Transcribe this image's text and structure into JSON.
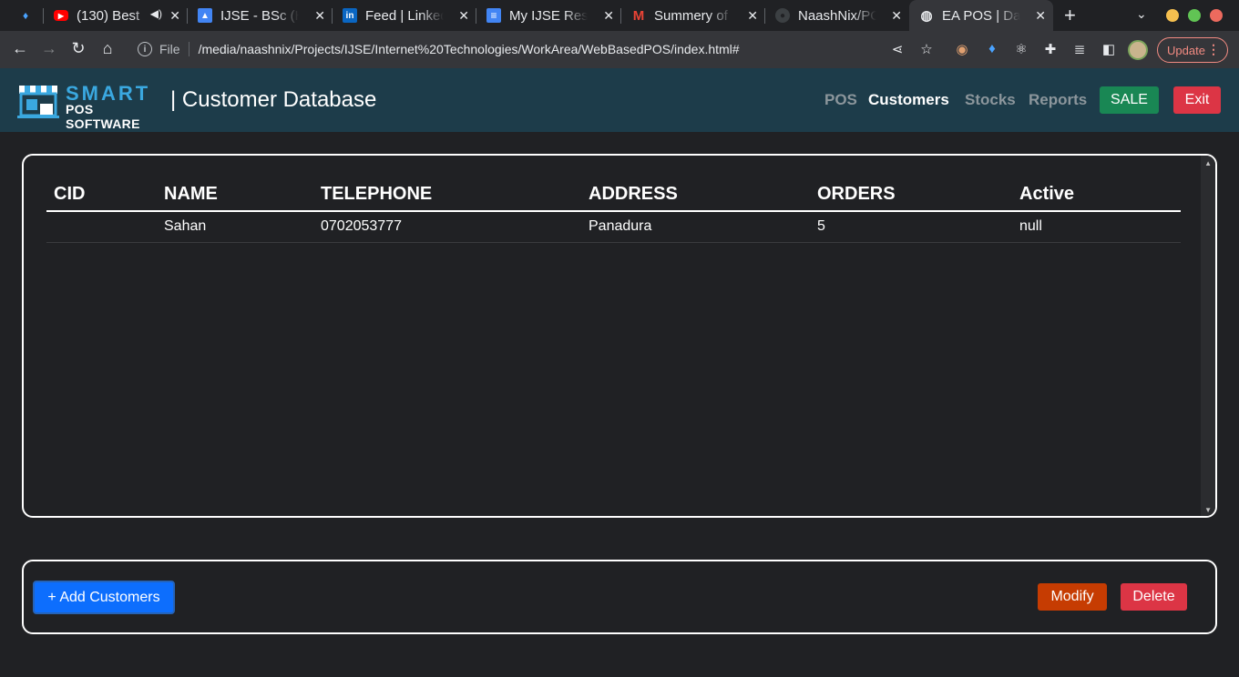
{
  "browser": {
    "tabs": [
      {
        "title": "",
        "icon": "gem-icon"
      },
      {
        "title": "(130) Best",
        "icon": "youtube-icon",
        "audio": true
      },
      {
        "title": "IJSE - BSc (H",
        "icon": "google-sites-icon"
      },
      {
        "title": "Feed | Linkedl",
        "icon": "linkedin-icon"
      },
      {
        "title": "My IJSE Resu",
        "icon": "google-docs-icon"
      },
      {
        "title": "Summery of M",
        "icon": "gmail-icon"
      },
      {
        "title": "NaashNix/PO",
        "icon": "github-icon"
      },
      {
        "title": "EA POS | Das",
        "icon": "globe-icon",
        "active": true
      }
    ],
    "address": {
      "scheme_label": "File",
      "url": "/media/naashnix/Projects/IJSE/Internet%20Technologies/WorkArea/WebBasedPOS/index.html#"
    },
    "update_label": "Update"
  },
  "app": {
    "logo": {
      "line1": "SMART",
      "line2": "POS SOFTWARE"
    },
    "page_title": "| Customer Database",
    "nav": [
      {
        "label": "POS",
        "active": false
      },
      {
        "label": "Customers",
        "active": true
      },
      {
        "label": "Stocks",
        "active": false
      },
      {
        "label": "Reports",
        "active": false
      }
    ],
    "sale_label": "SALE",
    "exit_label": "Exit"
  },
  "table": {
    "columns": [
      "CID",
      "NAME",
      "TELEPHONE",
      "ADDRESS",
      "ORDERS",
      "Active"
    ],
    "rows": [
      [
        "",
        "Sahan",
        "0702053777",
        "Panadura",
        "5",
        "null"
      ]
    ]
  },
  "actions": {
    "add_label": "+ Add Customers",
    "modify_label": "Modify",
    "delete_label": "Delete"
  },
  "colors": {
    "sale": "#198754",
    "exit": "#dc3545",
    "add": "#0d6efd",
    "modify": "#c63c02",
    "delete": "#dc3545",
    "navbar": "#1d3c4a"
  }
}
